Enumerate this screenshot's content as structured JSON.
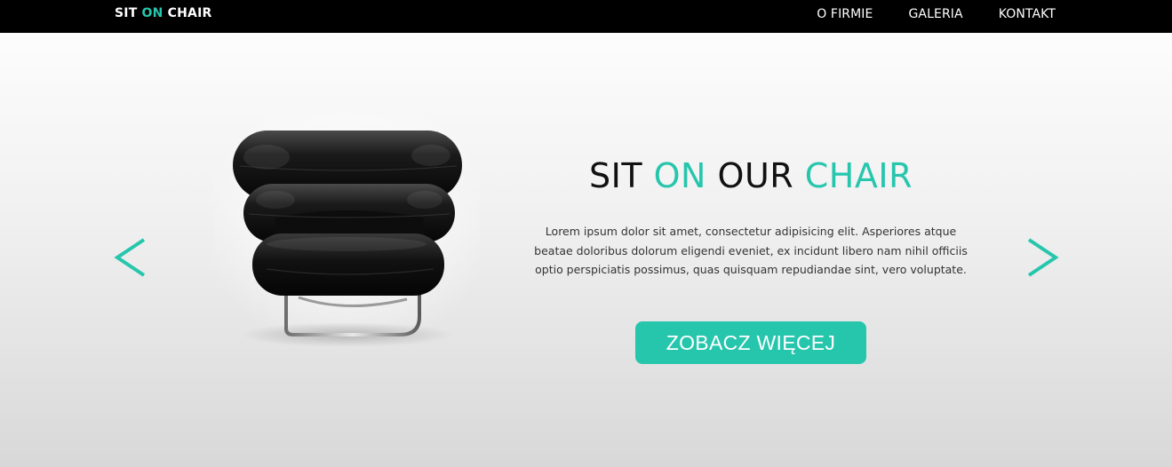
{
  "header": {
    "logo": {
      "part1": "SIT ",
      "part2": "ON",
      "part3": " CHAIR"
    },
    "nav": [
      {
        "label": "O FIRMIE"
      },
      {
        "label": "GALERIA"
      },
      {
        "label": "KONTAKT"
      }
    ]
  },
  "hero": {
    "title": {
      "part1": "SIT ",
      "part2": "ON",
      "part3": " OUR ",
      "part4": "CHAIR"
    },
    "description": "Lorem ipsum dolor sit amet, consectetur adipisicing elit. Asperiores atque beatae doloribus dolorum eligendi eveniet, ex incidunt libero nam nihil officiis optio perspiciatis possimus, quas quisquam repudiandae sint, vero voluptate.",
    "cta_label": "ZOBACZ WIĘCEJ",
    "prev_icon": "chevron-left-icon",
    "next_icon": "chevron-right-icon",
    "image": "black-leather-armchair"
  },
  "colors": {
    "accent": "#26c6ad",
    "topbar": "#000000",
    "text": "#111111"
  }
}
